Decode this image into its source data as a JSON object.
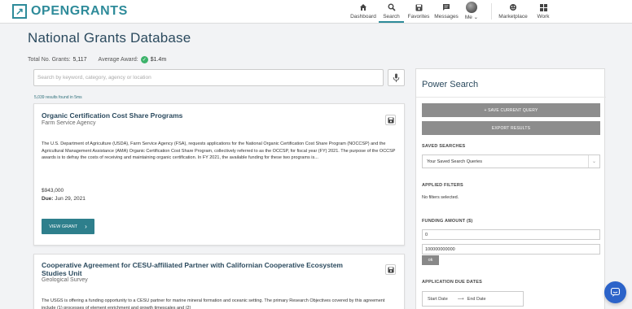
{
  "brand": {
    "name": "OPENGRANTS",
    "logo_glyph": "↗",
    "color": "#2e8b9a"
  },
  "nav": {
    "items": [
      {
        "label": "Dashboard",
        "icon": "home-icon"
      },
      {
        "label": "Search",
        "icon": "search-icon",
        "active": true
      },
      {
        "label": "Favorites",
        "icon": "save-icon"
      },
      {
        "label": "Messages",
        "icon": "message-icon"
      },
      {
        "label": "Me ⌄",
        "icon": "avatar"
      },
      {
        "label": "Marketplace",
        "icon": "marketplace-icon"
      },
      {
        "label": "Work",
        "icon": "grid-icon"
      }
    ]
  },
  "page": {
    "title": "National Grants Database",
    "total_label": "Total No. Grants:",
    "total_value": "5,117",
    "avg_label": "Average Award:",
    "avg_value": "$1.4m"
  },
  "search": {
    "placeholder": "Search by keyword, category, agency or location",
    "value": "",
    "results_text": "5,039 results found in 5ms"
  },
  "grants": [
    {
      "title": "Organic Certification Cost Share Programs",
      "agency": "Farm Service Agency",
      "description": "The U.S. Department of Agriculture (USDA), Farm Service Agency (FSA), requests applications for the National Organic Certification Cost Share Program (NOCCSP) and the Agricultural Management Assistance (AMA) Organic Certification Cost Share Program, collectively referred to as the OCCSP, for fiscal year (FY) 2021. The purpose of the OCCSP awards is to defray the costs of receiving and maintaining organic certification. In FY 2021, the available funding for these two programs is...",
      "amount": "$943,000",
      "due_label": "Due:",
      "due_date": "Jun 29, 2021",
      "button": "VIEW GRANT"
    },
    {
      "title": "Cooperative Agreement for CESU-affiliated Partner with Californian Cooperative Ecosystem Studies Unit",
      "agency": "Geological Survey",
      "description": "The USGS is offering a funding opportunity to a CESU partner for marine mineral formation and oceanic setting. The primary Research Objectives covered by this agreement include (1) processes of element enrichment and growth timescales and (2)"
    }
  ],
  "power_search": {
    "title": "Power Search",
    "save_query": "+ SAVE CURRENT QUERY",
    "export": "EXPORT RESULTS",
    "saved_label": "SAVED SEARCHES",
    "saved_select": "Your Saved Search Queries",
    "applied_label": "APPLIED FILTERS",
    "no_filters": "No filters selected.",
    "funding_label": "FUNDING AMOUNT ($)",
    "funding_min": "0",
    "funding_max": "100000000000",
    "ok": "ok",
    "due_label": "APPLICATION DUE DATES",
    "start_date": "Start Date",
    "end_date": "End Date"
  },
  "colors": {
    "accent": "#2e8b9a",
    "button": "#2e7f8c",
    "chat": "#2c63c9",
    "success": "#3db36b"
  }
}
